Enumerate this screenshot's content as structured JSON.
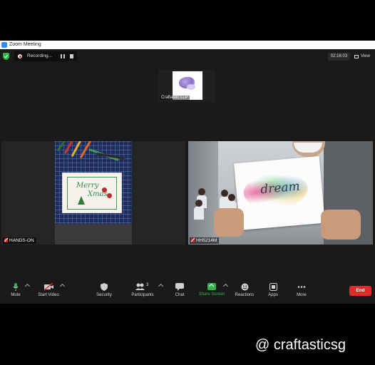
{
  "window": {
    "title": "Zoom Meeting"
  },
  "recording": {
    "label": "Recording..."
  },
  "timer": "02:16:03",
  "view_label": "View",
  "participants_tiles": {
    "host": {
      "name": "Craftastic LLP"
    },
    "left": {
      "name": "HANDS-ON",
      "card_line1": "Merry",
      "card_line2": "Xmas"
    },
    "right": {
      "name": "HH5214M",
      "card_word": "dream"
    }
  },
  "toolbar": {
    "mute": "Mute",
    "start_video": "Start Video",
    "security": "Security",
    "participants": "Participants",
    "participants_count": "3",
    "chat": "Chat",
    "share_screen": "Share Screen",
    "reactions": "Reactions",
    "apps": "Apps",
    "more": "More",
    "end": "End"
  },
  "watermark": "@ craftasticsg",
  "colors": {
    "accent_green": "#2fb34a",
    "end_red": "#e02b2b",
    "share_label": "#2fb34a"
  }
}
